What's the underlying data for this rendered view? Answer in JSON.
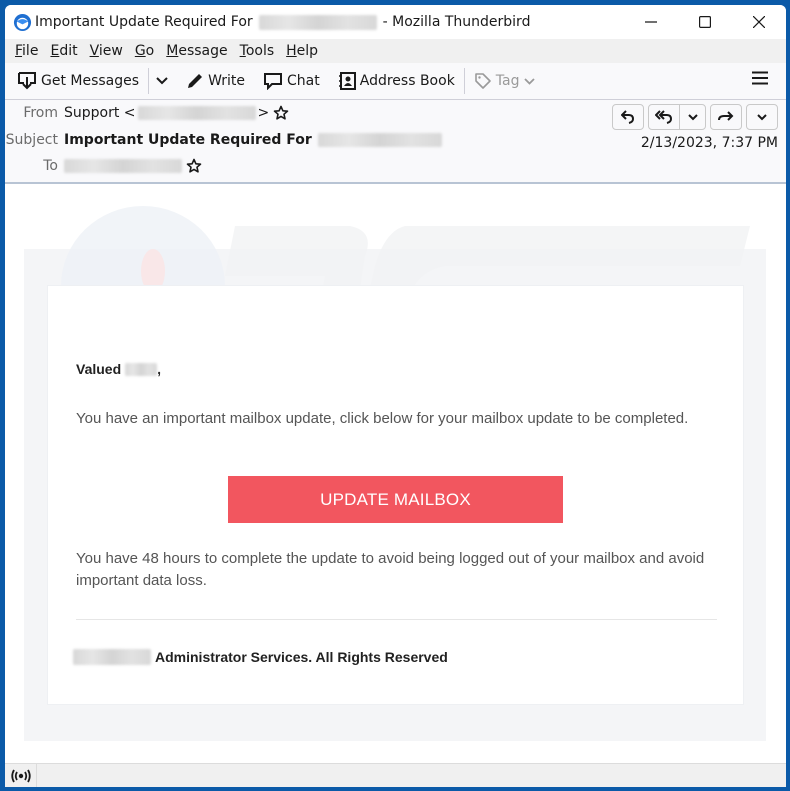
{
  "window": {
    "title_prefix": "Important Update Required For",
    "title_suffix": "- Mozilla Thunderbird",
    "controls": {
      "minimize": "minimize",
      "maximize": "maximize",
      "close": "close"
    }
  },
  "menu": {
    "items": [
      {
        "accel": "F",
        "rest": "ile"
      },
      {
        "accel": "E",
        "rest": "dit"
      },
      {
        "accel": "V",
        "rest": "iew"
      },
      {
        "accel": "G",
        "rest": "o"
      },
      {
        "accel": "M",
        "rest": "essage"
      },
      {
        "accel": "T",
        "rest": "ools"
      },
      {
        "accel": "H",
        "rest": "elp"
      }
    ]
  },
  "toolbar": {
    "get_messages": "Get Messages",
    "write": "Write",
    "chat": "Chat",
    "address_book": "Address Book",
    "tag": "Tag"
  },
  "header": {
    "from_label": "From",
    "from_name": "Support <",
    "from_close": ">",
    "subject_label": "Subject",
    "subject": "Important Update Required For",
    "to_label": "To",
    "date": "2/13/2023, 7:37 PM"
  },
  "email": {
    "greeting": "Valued",
    "greeting_comma": ",",
    "paragraph1": "You have an important mailbox update, click below for your mailbox update to be completed.",
    "button_label": "UPDATE MAILBOX",
    "paragraph2": "You have 48 hours to complete the update to avoid being logged out of your mailbox and avoid important data loss.",
    "footer": "Administrator Services. All Rights Reserved",
    "button_color": "#f2565f"
  },
  "colors": {
    "window_frame": "#0b5aa8",
    "accent": "#f2565f"
  }
}
